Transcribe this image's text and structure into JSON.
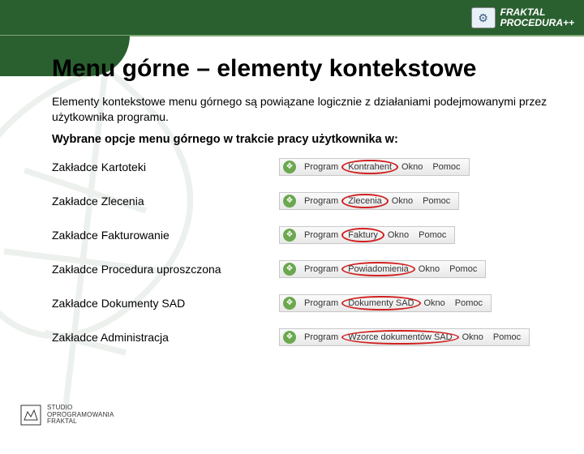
{
  "header": {
    "brand_line1": "FRAKTAL",
    "brand_line2": "PROCEDURA++"
  },
  "title": "Menu górne – elementy kontekstowe",
  "intro": "Elementy kontekstowe menu górnego są powiązane logicznie z działaniami podejmowanymi przez użytkownika programu.",
  "subtitle": "Wybrane opcje menu górnego w trakcie pracy użytkownika w:",
  "rows": [
    {
      "label": "Zakładce Kartoteki",
      "menu": [
        "Program",
        "Kontrahent",
        "Okno",
        "Pomoc"
      ],
      "highlight": 1
    },
    {
      "label": "Zakładce Zlecenia",
      "menu": [
        "Program",
        "Zlecenia",
        "Okno",
        "Pomoc"
      ],
      "highlight": 1
    },
    {
      "label": "Zakładce Fakturowanie",
      "menu": [
        "Program",
        "Faktury",
        "Okno",
        "Pomoc"
      ],
      "highlight": 1
    },
    {
      "label": "Zakładce Procedura uproszczona",
      "menu": [
        "Program",
        "Powiadomienia",
        "Okno",
        "Pomoc"
      ],
      "highlight": 1
    },
    {
      "label": "Zakładce Dokumenty SAD",
      "menu": [
        "Program",
        "Dokumenty SAD",
        "Okno",
        "Pomoc"
      ],
      "highlight": 1
    },
    {
      "label": "Zakładce Administracja",
      "menu": [
        "Program",
        "Wzorce dokumentów SAD",
        "Okno",
        "Pomoc"
      ],
      "highlight": 1
    }
  ],
  "footer": {
    "line1": "STUDIO",
    "line2": "OPROGRAMOWANIA",
    "line3": "FRAKTAL"
  }
}
